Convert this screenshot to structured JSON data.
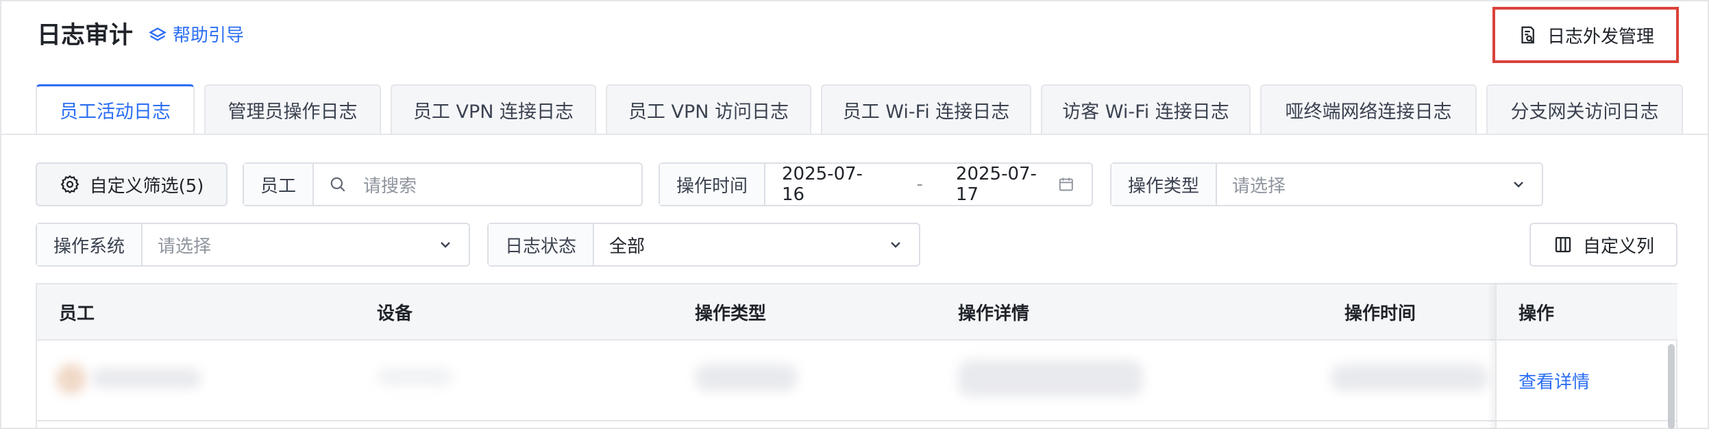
{
  "header": {
    "title": "日志审计",
    "help_label": "帮助引导",
    "export_label": "日志外发管理"
  },
  "tabs": [
    {
      "label": "员工活动日志",
      "active": true
    },
    {
      "label": "管理员操作日志"
    },
    {
      "label": "员工 VPN 连接日志"
    },
    {
      "label": "员工 VPN 访问日志"
    },
    {
      "label": "员工 Wi-Fi 连接日志"
    },
    {
      "label": "访客 Wi-Fi 连接日志"
    },
    {
      "label": "哑终端网络连接日志"
    },
    {
      "label": "分支网关访问日志"
    }
  ],
  "filters": {
    "custom_filter_label": "自定义筛选(5)",
    "employee": {
      "label": "员工",
      "placeholder": "请搜索"
    },
    "time": {
      "label": "操作时间",
      "start": "2025-07-16",
      "separator": "-",
      "end": "2025-07-17"
    },
    "op_type": {
      "label": "操作类型",
      "placeholder": "请选择"
    },
    "os": {
      "label": "操作系统",
      "placeholder": "请选择"
    },
    "status": {
      "label": "日志状态",
      "value": "全部"
    },
    "custom_columns_label": "自定义列"
  },
  "table": {
    "columns": [
      "员工",
      "设备",
      "操作类型",
      "操作详情",
      "操作时间",
      "操作"
    ],
    "rows": [
      {
        "action": "查看详情"
      }
    ]
  },
  "colors": {
    "accent": "#2b6ef2",
    "highlight_border": "#d9423b"
  }
}
